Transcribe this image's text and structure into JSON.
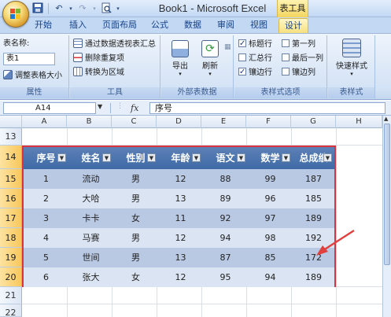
{
  "window": {
    "title": "Book1 - Microsoft Excel",
    "context_tab_group": "表工具"
  },
  "tabs": [
    "开始",
    "插入",
    "页面布局",
    "公式",
    "数据",
    "审阅",
    "视图",
    "设计"
  ],
  "active_tab": "设计",
  "ribbon": {
    "properties": {
      "table_name_label": "表名称:",
      "table_name_value": "表1",
      "resize_label": "调整表格大小",
      "group_label": "属性"
    },
    "tools": {
      "pivot_label": "通过数据透视表汇总",
      "remove_duplicates_label": "删除重复项",
      "convert_range_label": "转换为区域",
      "group_label": "工具"
    },
    "external": {
      "export_label": "导出",
      "refresh_label": "刷新",
      "group_label": "外部表数据"
    },
    "style_options": {
      "header_row": {
        "label": "标题行",
        "checked": true
      },
      "total_row": {
        "label": "汇总行",
        "checked": false
      },
      "banded_rows": {
        "label": "镶边行",
        "checked": true
      },
      "first_column": {
        "label": "第一列",
        "checked": false
      },
      "last_column": {
        "label": "最后一列",
        "checked": false
      },
      "banded_columns": {
        "label": "镶边列",
        "checked": false
      },
      "group_label": "表样式选项"
    },
    "styles": {
      "quick_styles_label": "快速样式",
      "group_label": "表样式"
    }
  },
  "formula_bar": {
    "name_box": "A14",
    "fx_symbol": "fx",
    "formula": "序号"
  },
  "grid": {
    "columns": [
      "A",
      "B",
      "C",
      "D",
      "E",
      "F",
      "G",
      "H"
    ],
    "rows": [
      "13",
      "14",
      "15",
      "16",
      "17",
      "18",
      "19",
      "20",
      "21",
      "22"
    ]
  },
  "table": {
    "headers": [
      "序号",
      "姓名",
      "性别",
      "年龄",
      "语文",
      "数学",
      "总成绩"
    ],
    "rows": [
      [
        "1",
        "流动",
        "男",
        "12",
        "88",
        "99",
        "187"
      ],
      [
        "2",
        "大哈",
        "男",
        "13",
        "89",
        "96",
        "185"
      ],
      [
        "3",
        "卡卡",
        "女",
        "11",
        "92",
        "97",
        "189"
      ],
      [
        "4",
        "马赛",
        "男",
        "12",
        "94",
        "98",
        "192"
      ],
      [
        "5",
        "世间",
        "男",
        "13",
        "87",
        "85",
        "172"
      ],
      [
        "6",
        "张大",
        "女",
        "12",
        "95",
        "94",
        "189"
      ]
    ]
  },
  "colors": {
    "header_fill": "#4f74ae",
    "band_dark": "#b9c9e4",
    "band_light": "#dbe4f2",
    "selection_border": "#d9343e",
    "annotation_arrow": "#e0403e"
  }
}
